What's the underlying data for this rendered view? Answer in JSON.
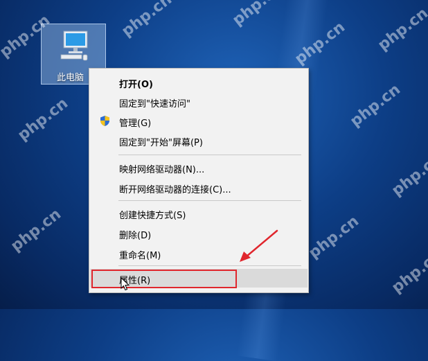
{
  "desktop": {
    "icon_label": "此电脑",
    "watermark_text": "php.cn"
  },
  "context_menu": {
    "items": [
      {
        "label": "打开(O)",
        "bold": true
      },
      {
        "label": "固定到\"快速访问\""
      },
      {
        "label": "管理(G)",
        "icon": "uac-shield-icon"
      },
      {
        "label": "固定到\"开始\"屏幕(P)"
      },
      {
        "label": "映射网络驱动器(N)..."
      },
      {
        "label": "断开网络驱动器的连接(C)..."
      },
      {
        "label": "创建快捷方式(S)"
      },
      {
        "label": "删除(D)"
      },
      {
        "label": "重命名(M)"
      },
      {
        "label": "属性(R)",
        "highlighted": true
      }
    ]
  },
  "annotation": {
    "highlight_color": "#e0262d",
    "arrow_color": "#e0262d"
  }
}
